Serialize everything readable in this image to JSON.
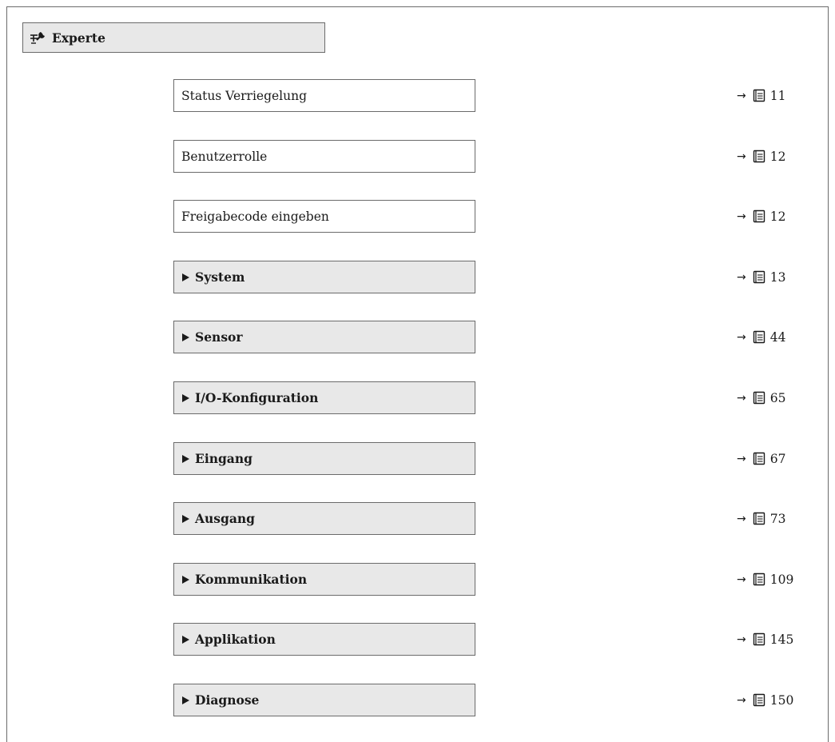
{
  "header": {
    "icon": "expert-wrench-icon",
    "title": "Experte"
  },
  "items": [
    {
      "label": "Status Verriegelung",
      "kind": "parameter",
      "arrow": "→",
      "page": "11"
    },
    {
      "label": "Benutzerrolle",
      "kind": "parameter",
      "arrow": "→",
      "page": "12"
    },
    {
      "label": "Freigabecode eingeben",
      "kind": "parameter",
      "arrow": "→",
      "page": "12"
    },
    {
      "label": "System",
      "kind": "submenu",
      "arrow": "→",
      "page": "13"
    },
    {
      "label": "Sensor",
      "kind": "submenu",
      "arrow": "→",
      "page": "44"
    },
    {
      "label": "I/O-Konfiguration",
      "kind": "submenu",
      "arrow": "→",
      "page": "65"
    },
    {
      "label": "Eingang",
      "kind": "submenu",
      "arrow": "→",
      "page": "67"
    },
    {
      "label": "Ausgang",
      "kind": "submenu",
      "arrow": "→",
      "page": "73"
    },
    {
      "label": "Kommunikation",
      "kind": "submenu",
      "arrow": "→",
      "page": "109"
    },
    {
      "label": "Applikation",
      "kind": "submenu",
      "arrow": "→",
      "page": "145"
    },
    {
      "label": "Diagnose",
      "kind": "submenu",
      "arrow": "→",
      "page": "150"
    }
  ],
  "colors": {
    "submenu_fill": "#e8e8e8",
    "border": "#6b6b6b",
    "text": "#1a1a1a"
  }
}
